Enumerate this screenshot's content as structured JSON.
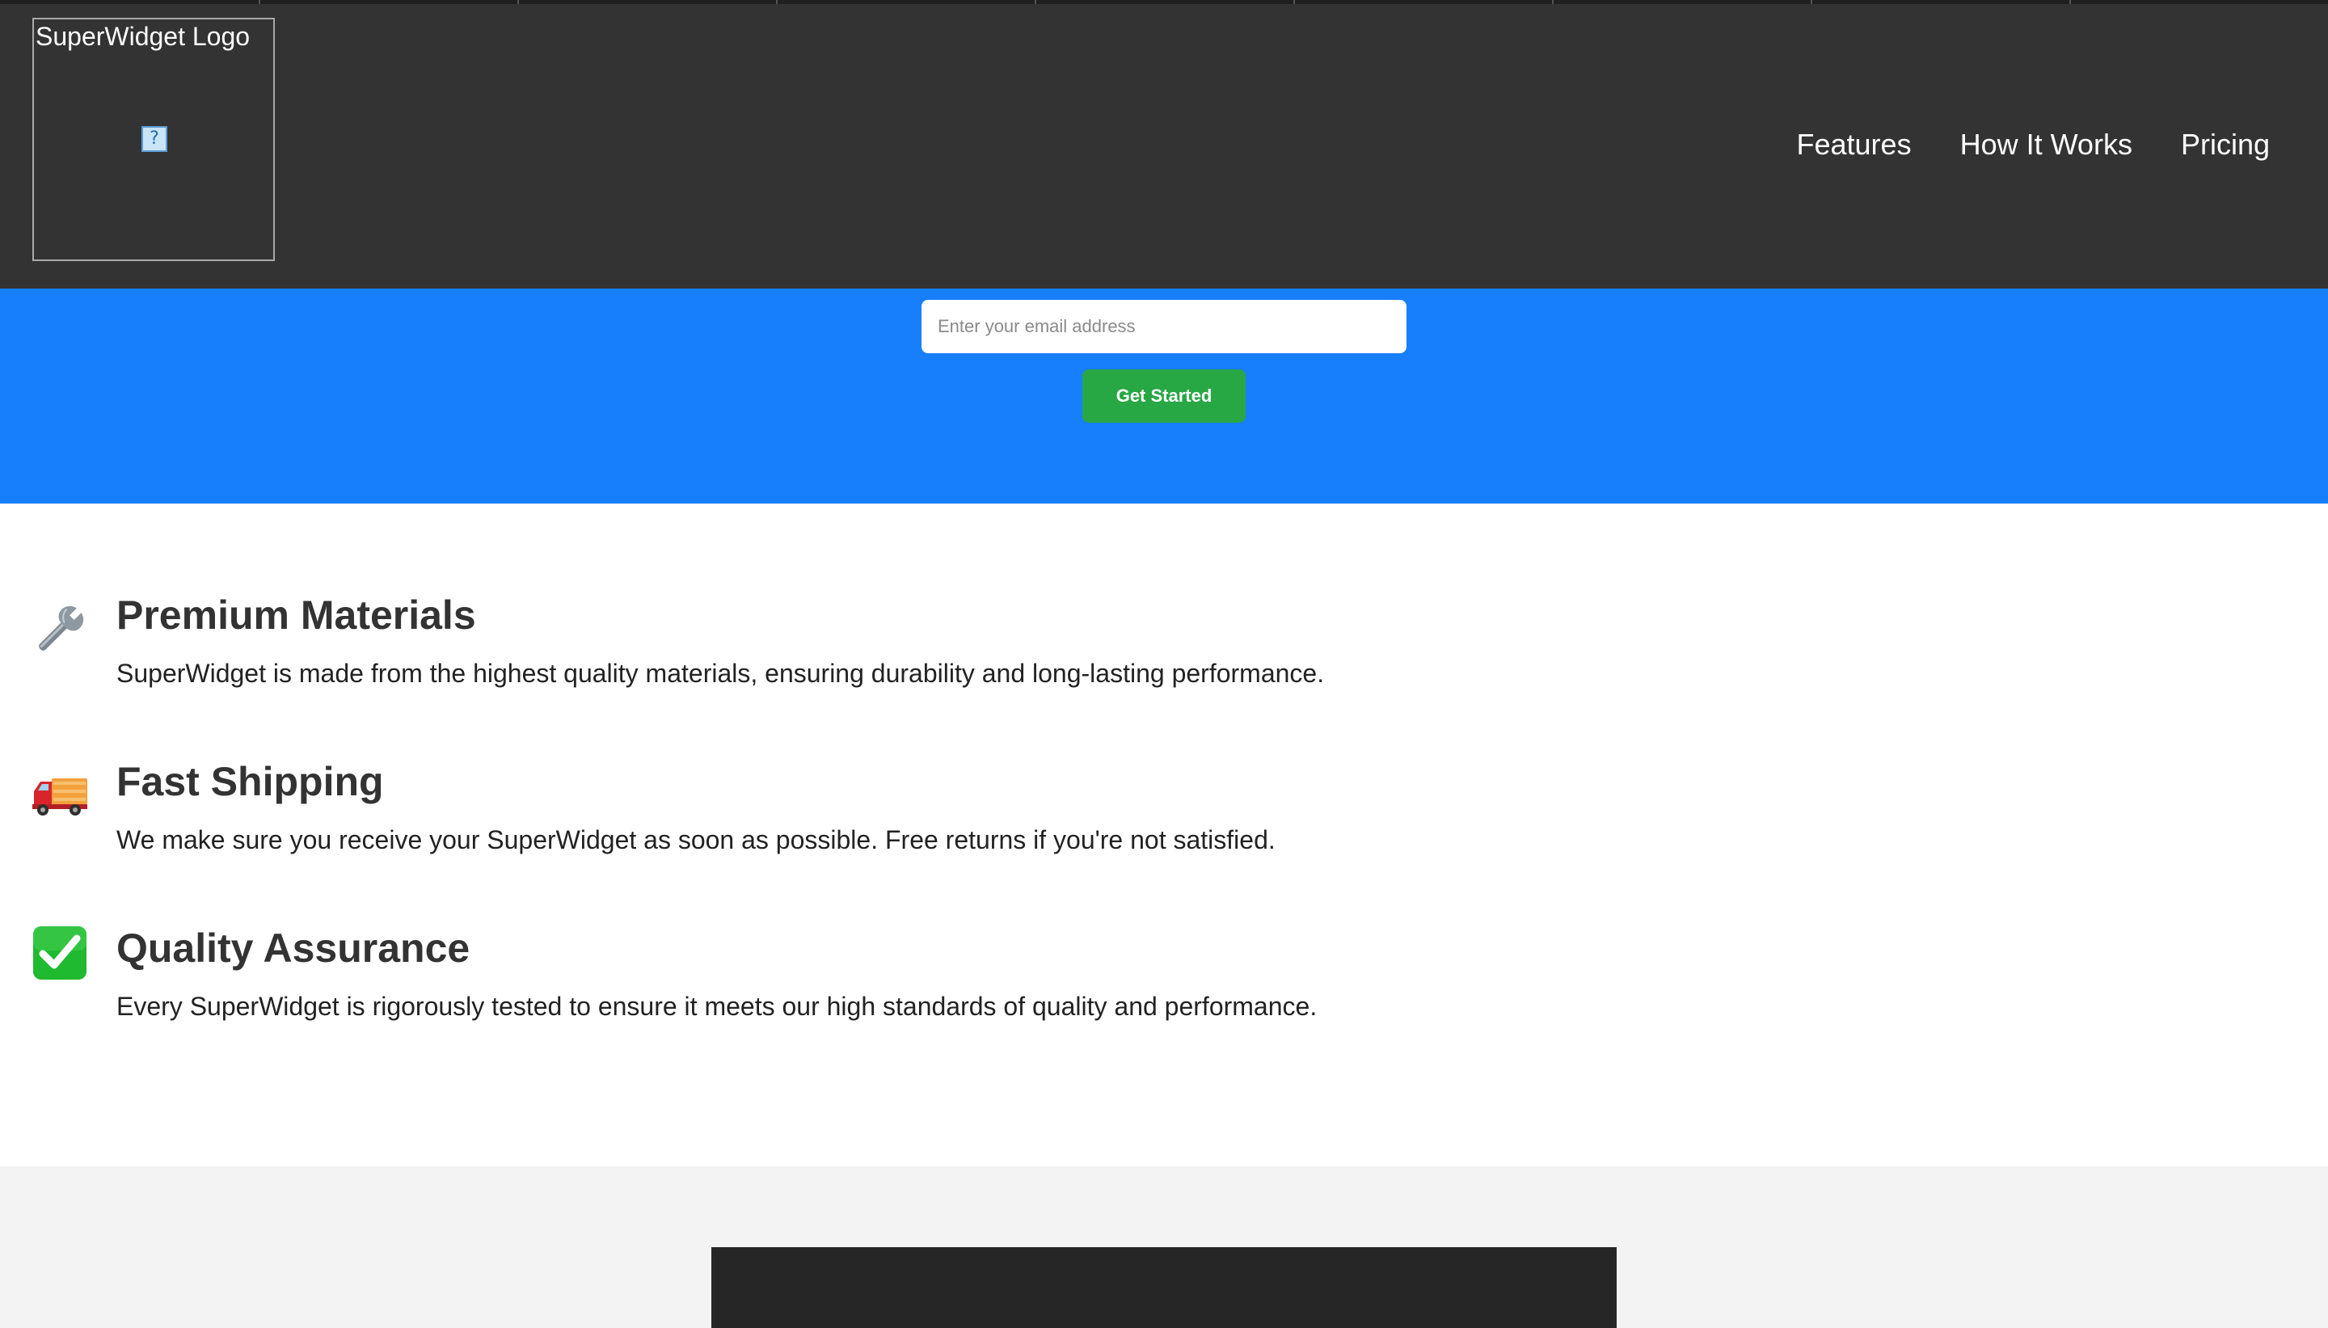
{
  "header": {
    "logo_alt": "SuperWidget Logo",
    "broken_image_glyph": "?",
    "nav": [
      {
        "label": "Features"
      },
      {
        "label": "How It Works"
      },
      {
        "label": "Pricing"
      }
    ]
  },
  "hero": {
    "email_placeholder": "Enter your email address",
    "cta_label": "Get Started"
  },
  "features": [
    {
      "icon": "wrench-icon",
      "title": "Premium Materials",
      "description": "SuperWidget is made from the highest quality materials, ensuring durability and long-lasting performance."
    },
    {
      "icon": "delivery-truck-icon",
      "title": "Fast Shipping",
      "description": "We make sure you receive your SuperWidget as soon as possible. Free returns if you're not satisfied."
    },
    {
      "icon": "check-mark-icon",
      "title": "Quality Assurance",
      "description": "Every SuperWidget is rigorously tested to ensure it meets our high standards of quality and performance."
    }
  ],
  "colors": {
    "header_bg": "#333333",
    "hero_bg": "#177ffb",
    "cta_bg": "#28a745",
    "bottom_bg": "#f3f3f3",
    "dark_panel": "#262626"
  }
}
